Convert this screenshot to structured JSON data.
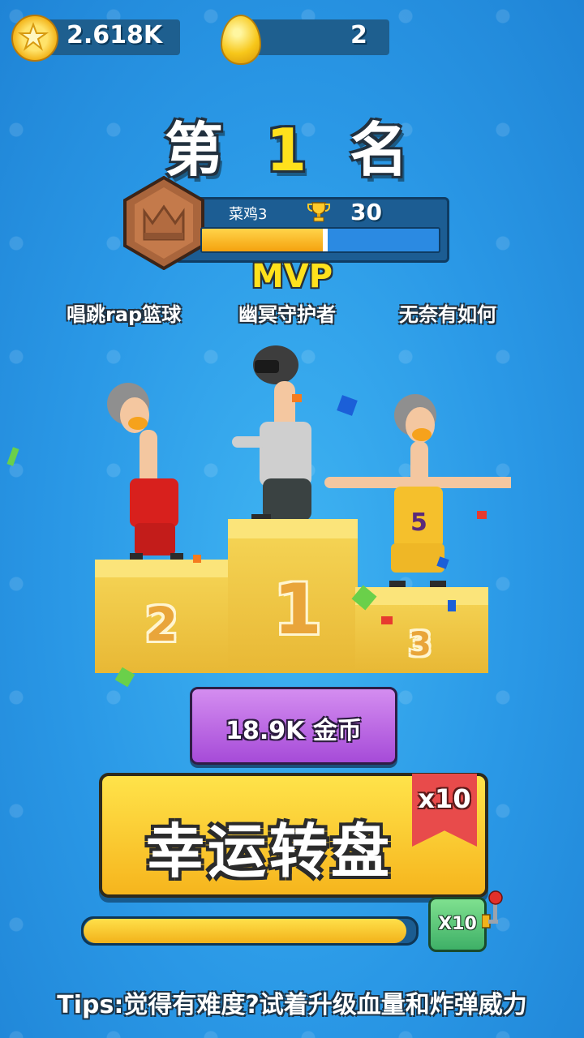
{
  "topbar": {
    "gold_coins": "2.618K",
    "eggs": "2"
  },
  "result": {
    "rank_prefix": "第",
    "rank_number": "1",
    "rank_suffix": "名"
  },
  "player": {
    "name": "菜鸡3",
    "trophies": "30",
    "progress": 0.52
  },
  "mvp": {
    "label": "MVP",
    "players": [
      "唱跳rap篮球",
      "幽冥守护者",
      "无奈有如何"
    ]
  },
  "podium": {
    "places": [
      "2",
      "1",
      "3"
    ]
  },
  "reward": {
    "coins_label": "18.9K 金币",
    "wheel_label": "幸运转盘",
    "wheel_multiplier": "x10",
    "x10_button": "X10",
    "meter_progress": 0.97
  },
  "tips": "Tips:觉得有难度?试着升级血量和炸弹威力",
  "colors": {
    "background": "#2a98e6",
    "accent_yellow": "#ffe11c",
    "purple_button": "#b25ee0",
    "green_button": "#3eb067",
    "ribbon_red": "#e84b4b"
  }
}
